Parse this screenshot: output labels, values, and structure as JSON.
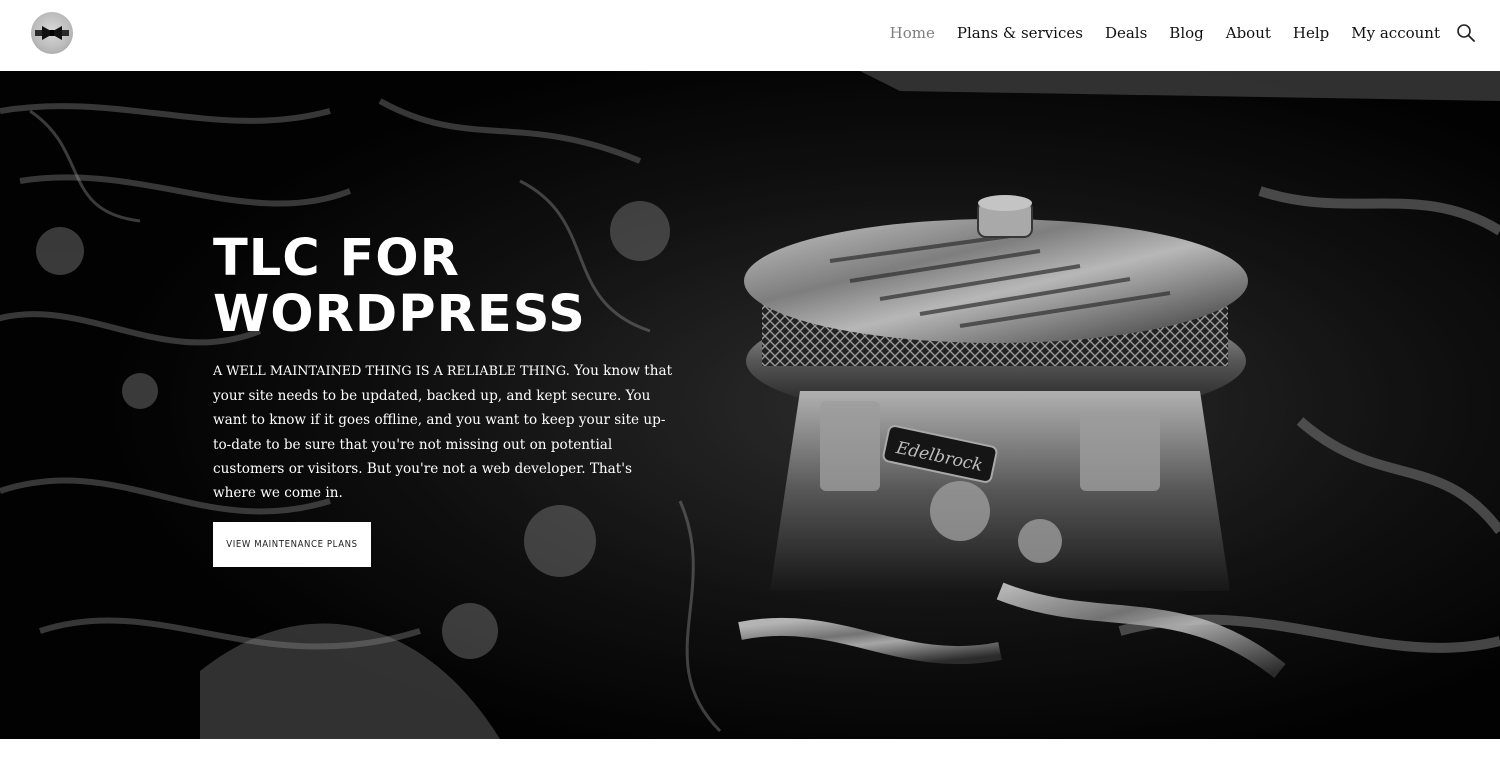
{
  "header": {
    "logo_icon": "bowtie-logo",
    "nav": [
      {
        "label": "Home",
        "active": true
      },
      {
        "label": "Plans & services",
        "active": false
      },
      {
        "label": "Deals",
        "active": false
      },
      {
        "label": "Blog",
        "active": false
      },
      {
        "label": "About",
        "active": false
      },
      {
        "label": "Help",
        "active": false
      },
      {
        "label": "My account",
        "active": false
      }
    ],
    "search_icon": "search-icon"
  },
  "hero": {
    "title_line1": "TLC FOR",
    "title_line2": "WORDPRESS",
    "lead": "A well maintained thing is a reliable thing.",
    "body": " You know that your site needs to be updated, backed up, and kept secure. You want to know if it goes offline, and you want to keep your site up-to-date to be sure that you're not missing out on potential customers or visitors. But you're not a web developer. That's where we come in.",
    "button_label": "View maintenance plans",
    "background_image": "engine-carburetor-photo",
    "engine_badge": "Edelbrock"
  },
  "colors": {
    "nav_text": "#111111",
    "nav_active": "#7f7f7f",
    "hero_bg": "#050505",
    "hero_text": "#ffffff",
    "button_bg": "#ffffff"
  }
}
